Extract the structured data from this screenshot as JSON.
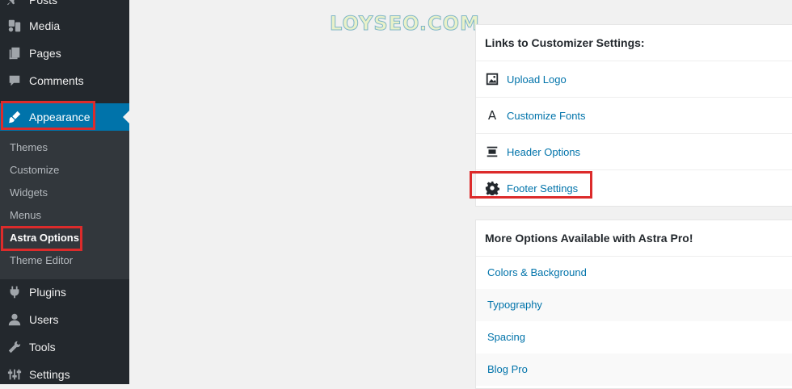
{
  "sidebar": {
    "top_items": [
      {
        "label": "Posts",
        "icon": "pin-icon"
      },
      {
        "label": "Media",
        "icon": "media-icon"
      },
      {
        "label": "Pages",
        "icon": "pages-icon"
      },
      {
        "label": "Comments",
        "icon": "comments-icon"
      },
      {
        "label": "Appearance",
        "icon": "brush-icon"
      }
    ],
    "submenu": [
      "Themes",
      "Customize",
      "Widgets",
      "Menus",
      "Astra Options",
      "Theme Editor"
    ],
    "bottom_items": [
      {
        "label": "Plugins",
        "icon": "plugin-icon"
      },
      {
        "label": "Users",
        "icon": "users-icon"
      },
      {
        "label": "Tools",
        "icon": "wrench-icon"
      },
      {
        "label": "Settings",
        "icon": "settings-icon"
      }
    ]
  },
  "watermark": "LOYSEO.COM",
  "customizer_card": {
    "title": "Links to Customizer Settings:",
    "links": [
      {
        "label": "Upload Logo",
        "icon": "image-icon"
      },
      {
        "label": "Customize Fonts",
        "icon": "font-icon",
        "glyph": "A"
      },
      {
        "label": "Header Options",
        "icon": "header-icon"
      },
      {
        "label": "Footer Settings",
        "icon": "gear-icon"
      }
    ]
  },
  "pro_card": {
    "title": "More Options Available with Astra Pro!",
    "links": [
      "Colors & Background",
      "Typography",
      "Spacing",
      "Blog Pro"
    ]
  },
  "colors": {
    "sidebar_bg": "#23282d",
    "submenu_bg": "#32373c",
    "active_bg": "#0073aa",
    "link": "#0073aa",
    "highlight": "#dc2b2b"
  }
}
